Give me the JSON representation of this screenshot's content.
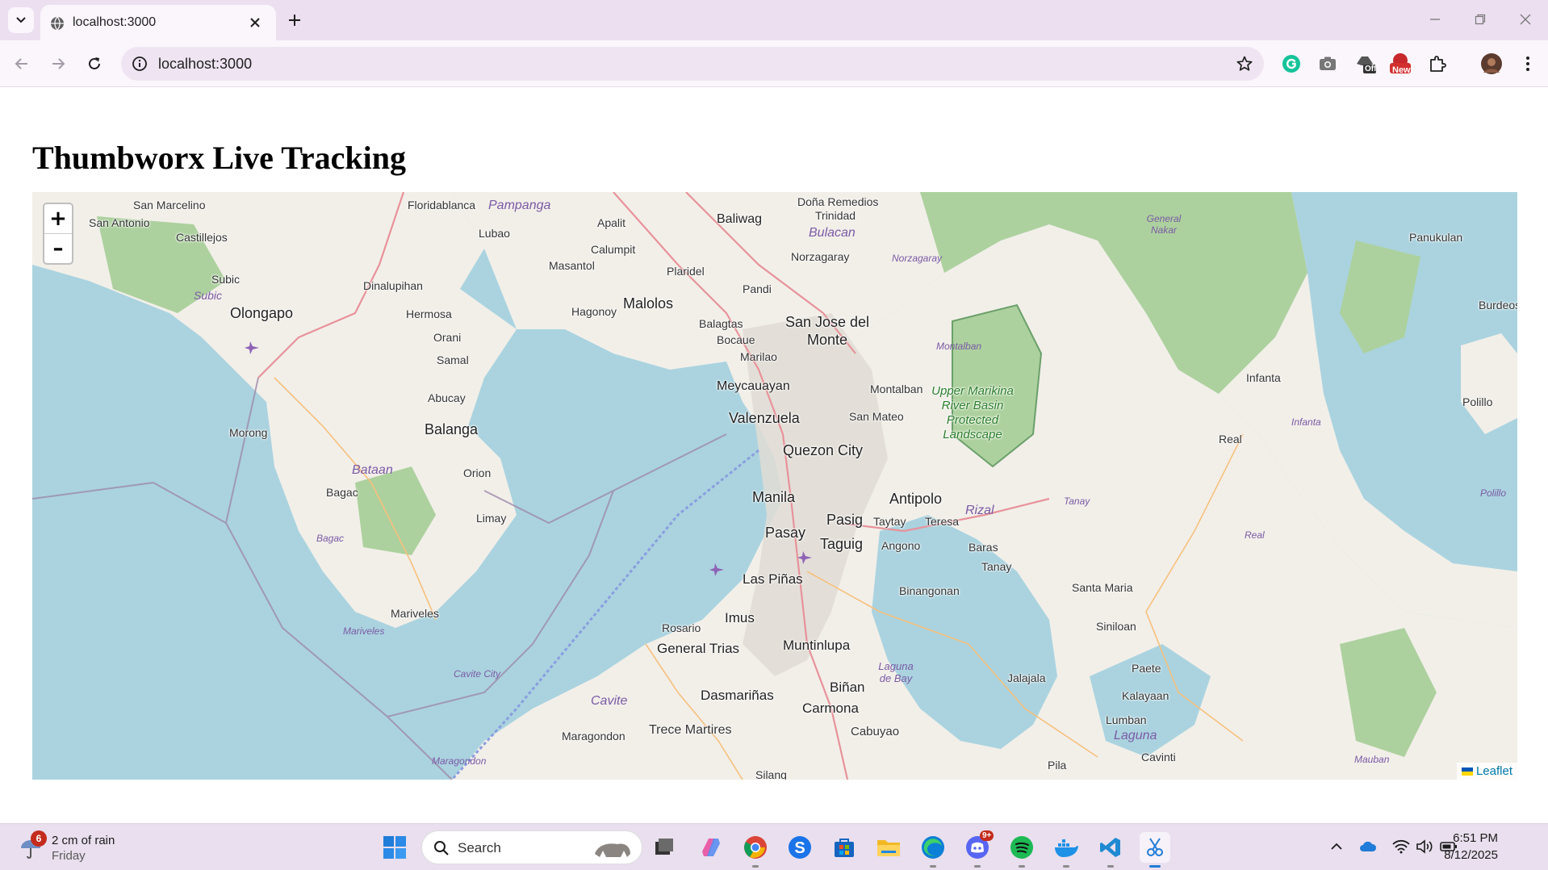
{
  "browser": {
    "tab_title": "localhost:3000",
    "url": "localhost:3000"
  },
  "page": {
    "title": "Thumbworx Live Tracking"
  },
  "map": {
    "zoom_in": "+",
    "zoom_out": "–",
    "attribution": "Leaflet",
    "places": {
      "san_marcelino": "San Marcelino",
      "san_antonio": "San Antonio",
      "castillejos": "Castillejos",
      "subic": "Subic",
      "subic_bay": "Subic",
      "olongapo": "Olongapo",
      "dinalupihan": "Dinalupihan",
      "floridablanca": "Floridablanca",
      "pampanga": "Pampanga",
      "lubao": "Lubao",
      "apalit": "Apalit",
      "calumpit": "Calumpit",
      "masantol": "Masantol",
      "baliwag": "Baliwag",
      "plaridel": "Plaridel",
      "bulacan": "Bulacan",
      "dona_remedios": "Doña Remedios",
      "trinidad": "Trinidad",
      "norzagaray": "Norzagaray",
      "norzagaray_w": "Norzagaray",
      "pandi": "Pandi",
      "hermosa": "Hermosa",
      "orani": "Orani",
      "hagonoy": "Hagonoy",
      "malolos": "Malolos",
      "balagtas": "Balagtas",
      "bocaue": "Bocaue",
      "marilao": "Marilao",
      "sjdm": "San Jose del Monte",
      "samal": "Samal",
      "abucay": "Abucay",
      "morong": "Morong",
      "balanga": "Balanga",
      "bataan": "Bataan",
      "orion": "Orion",
      "bagac": "Bagac",
      "bagac_bay": "Bagac",
      "limay": "Limay",
      "mariveles": "Mariveles",
      "mariveles_w": "Mariveles",
      "meycauayan": "Meycauayan",
      "valenzuela": "Valenzuela",
      "montalban": "Montalban",
      "montalban_w": "Montalban",
      "san_mateo": "San Mateo",
      "quezon_city": "Quezon City",
      "manila": "Manila",
      "antipolo": "Antipolo",
      "rizal": "Rizal",
      "pasig": "Pasig",
      "taytay": "Taytay",
      "teresa": "Teresa",
      "pasay": "Pasay",
      "taguig": "Taguig",
      "angono": "Angono",
      "baras": "Baras",
      "tanay": "Tanay",
      "tanay_w": "Tanay",
      "binangonan": "Binangonan",
      "las_pinas": "Las Piñas",
      "imus": "Imus",
      "rosario": "Rosario",
      "general_trias": "General Trias",
      "muntinlupa": "Muntinlupa",
      "laguna_de_bay": "Laguna de Bay",
      "cavite_city": "Cavite City",
      "cavite": "Cavite",
      "dasmarinas": "Dasmariñas",
      "binan": "Biñan",
      "carmona": "Carmona",
      "cabuyao": "Cabuyao",
      "trece_martires": "Trece Martires",
      "maragondon": "Maragondon",
      "maragondon_w": "Maragondon",
      "silang": "Silang",
      "general_nakar": "General Nakar",
      "panukulan": "Panukulan",
      "burdeos": "Burdeos",
      "infanta": "Infanta",
      "infanta_w": "Infanta",
      "polillo": "Polillo",
      "polillo_w": "Polillo",
      "real": "Real",
      "real_w": "Real",
      "santa_maria": "Santa Maria",
      "siniloan": "Siniloan",
      "paete": "Paete",
      "jalajala": "Jalajala",
      "kalayaan": "Kalayaan",
      "lumban": "Lumban",
      "laguna": "Laguna",
      "cavinti": "Cavinti",
      "pila": "Pila",
      "mauban": "Mauban",
      "upper_marikina": "Upper Marikina River Basin Protected Landscape"
    }
  },
  "taskbar": {
    "weather_badge": "6",
    "weather_line1": "2 cm of rain",
    "weather_line2": "Friday",
    "search_label": "Search",
    "discord_badge": "9+",
    "time": "6:51 PM",
    "date": "8/12/2025"
  },
  "extensions": {
    "off_badge": "Off",
    "new_badge": "New"
  }
}
